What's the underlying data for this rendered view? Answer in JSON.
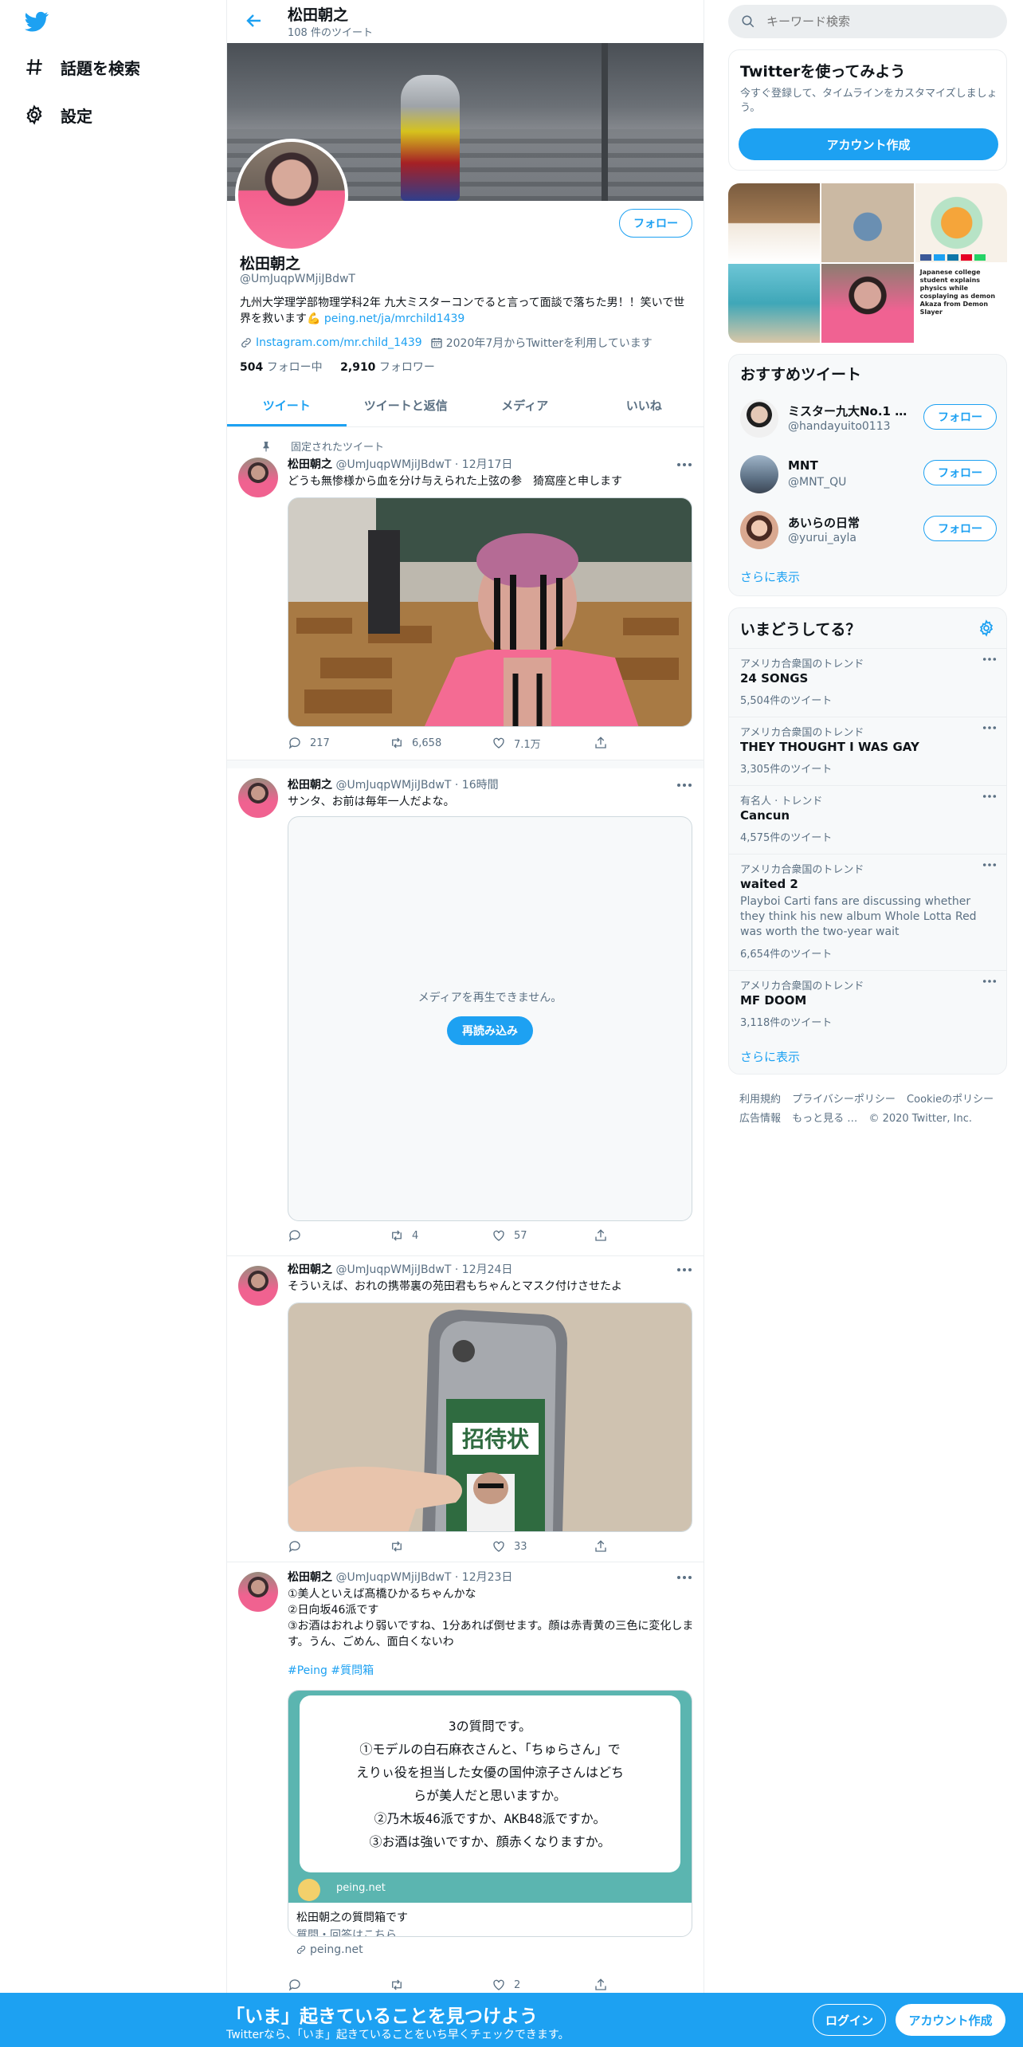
{
  "nav": {
    "explore_label": "話題を検索",
    "settings_label": "設定"
  },
  "header": {
    "title": "松田朝之",
    "tweet_count": "108 件のツイート"
  },
  "profile": {
    "name": "松田朝之",
    "handle": "@UmJuqpWMjiJBdwT",
    "bio": "九州大学理学部物理学科2年 九大ミスターコンでると言って面談で落ちた男！！笑いで世界を救います💪",
    "bio_link": "peing.net/ja/mrchild1439",
    "website": "Instagram.com/mr.child_1439",
    "joined": "2020年7月からTwitterを利用しています",
    "following_count": "504",
    "following_label": "フォロー中",
    "followers_count": "2,910",
    "followers_label": "フォロワー",
    "follow_button": "フォロー"
  },
  "tabs": [
    "ツイート",
    "ツイートと返信",
    "メディア",
    "いいね"
  ],
  "tweets": [
    {
      "pinned_label": "固定されたツイート",
      "name": "松田朝之",
      "handle": "@UmJuqpWMjiJBdwT",
      "time": "12月17日",
      "text": "どうも無惨様から血を分け与えられた上弦の参　猗窩座と申します",
      "replies": "217",
      "retweets": "6,658",
      "likes": "7.1万"
    },
    {
      "name": "松田朝之",
      "handle": "@UmJuqpWMjiJBdwT",
      "time": "16時間",
      "text": "サンタ、お前は毎年一人だよな。",
      "media_error": "メディアを再生できません。",
      "reload_button": "再読み込み",
      "replies": "",
      "retweets": "4",
      "likes": "57"
    },
    {
      "name": "松田朝之",
      "handle": "@UmJuqpWMjiJBdwT",
      "time": "12月24日",
      "text": "そういえば、おれの携帯裏の苑田君もちゃんとマスク付けさせたよ",
      "phone_sticker_label": "招待状",
      "replies": "",
      "retweets": "",
      "likes": "33"
    },
    {
      "name": "松田朝之",
      "handle": "@UmJuqpWMjiJBdwT",
      "time": "12月23日",
      "text_lines": [
        "①美人といえば髙橋ひかるちゃんかな",
        "②日向坂46派です",
        "③お酒はおれより弱いですね、1分あれば倒せます。顔は赤青黄の三色に変化します。うん、ごめん、面白くないわ"
      ],
      "hashtags": "#Peing #質問箱",
      "card_question_lines": [
        "3の質問です。",
        "①モデルの白石麻衣さんと、「ちゅらさん」で",
        "えりぃ役を担当した女優の国仲涼子さんはどち",
        "らが美人だと思いますか。",
        "②乃木坂46派ですか、AKB48派ですか。",
        "③お酒は強いですか、顔赤くなりますか。"
      ],
      "card_brand": "peing.net",
      "card_title": "松田朝之の質問箱です",
      "card_desc": "質問・回答はこちら",
      "card_domain": "peing.net",
      "replies": "",
      "retweets": "",
      "likes": "2"
    }
  ],
  "right": {
    "search_placeholder": "キーワード検索",
    "signup_card": {
      "title": "Twitterを使ってみよう",
      "desc": "今すぐ登録して、タイムラインをカスタマイズしましょう。",
      "button": "アカウント作成"
    },
    "media_grid_caption": "Japanese college student explains physics while cosplaying as demon Akaza from Demon Slayer",
    "recommend": {
      "title": "おすすめツイート",
      "users": [
        {
          "name": "ミスター九大No.1 半...",
          "handle": "@handayuito0113",
          "button": "フォロー"
        },
        {
          "name": "MNT",
          "handle": "@MNT_QU",
          "button": "フォロー"
        },
        {
          "name": "あいらの日常",
          "handle": "@yurui_ayla",
          "button": "フォロー"
        }
      ],
      "more": "さらに表示"
    },
    "trends": {
      "title": "いまどうしてる？",
      "items": [
        {
          "context": "アメリカ合衆国のトレンド",
          "name": "24 SONGS",
          "count": "5,504件のツイート"
        },
        {
          "context": "アメリカ合衆国のトレンド",
          "name": "THEY THOUGHT I WAS GAY",
          "count": "3,305件のツイート"
        },
        {
          "context": "有名人 · トレンド",
          "name": "Cancun",
          "count": "4,575件のツイート"
        },
        {
          "context": "アメリカ合衆国のトレンド",
          "name": "waited 2",
          "desc": "Playboi Carti fans are discussing whether they think his new album Whole Lotta Red was worth the two-year wait",
          "count": "6,654件のツイート"
        },
        {
          "context": "アメリカ合衆国のトレンド",
          "name": "MF DOOM",
          "count": "3,118件のツイート"
        }
      ],
      "more": "さらに表示"
    },
    "footer": {
      "links": [
        "利用規約",
        "プライバシーポリシー",
        "Cookieのポリシー",
        "広告情報",
        "もっと見る …"
      ],
      "copyright": "© 2020 Twitter, Inc."
    }
  },
  "bottom_bar": {
    "title": "「いま」起きていることを見つけよう",
    "subtitle": "Twitterなら、「いま」起きていることをいち早くチェックできます。",
    "login": "ログイン",
    "signup": "アカウント作成"
  }
}
